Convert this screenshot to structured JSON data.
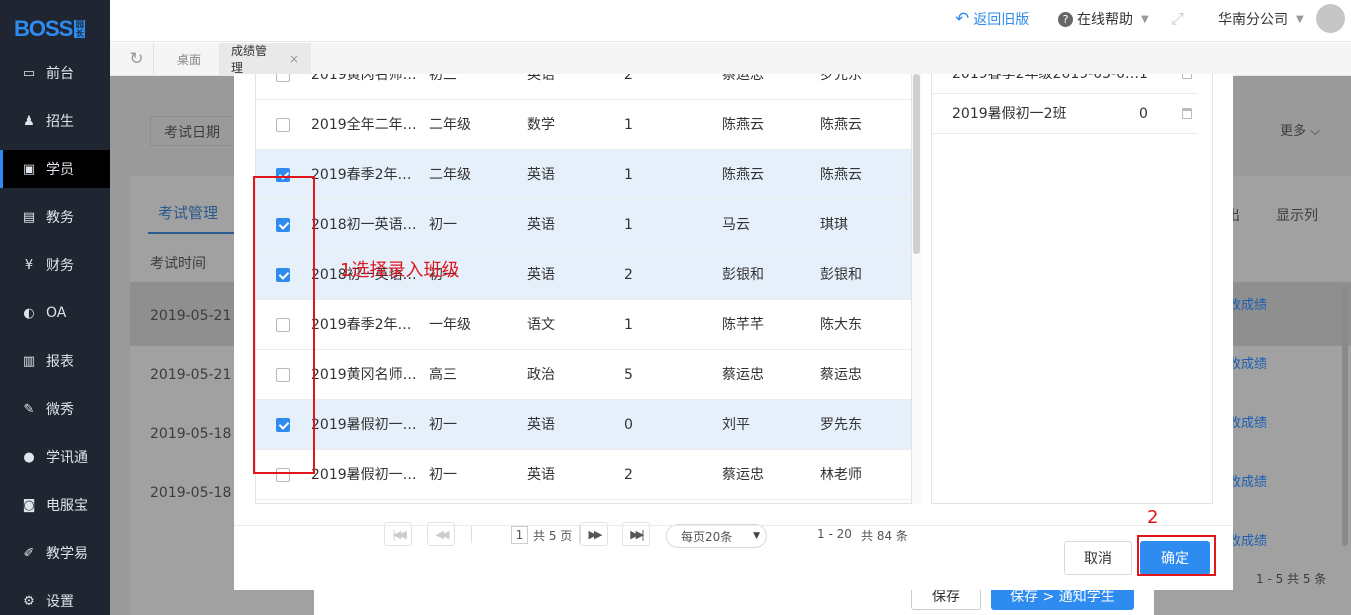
{
  "brand": {
    "logo": "BOSS",
    "logo_tag": "园长"
  },
  "sidebar": {
    "items": [
      {
        "label": "前台",
        "icon": "monitor-icon"
      },
      {
        "label": "招生",
        "icon": "user-add-icon"
      },
      {
        "label": "学员",
        "icon": "contact-card-icon"
      },
      {
        "label": "教务",
        "icon": "book-icon"
      },
      {
        "label": "财务",
        "icon": "yen-icon"
      },
      {
        "label": "OA",
        "icon": "oa-icon"
      },
      {
        "label": "报表",
        "icon": "bar-chart-icon"
      },
      {
        "label": "微秀",
        "icon": "weixiu-icon"
      },
      {
        "label": "学讯通",
        "icon": "location-icon"
      },
      {
        "label": "电服宝",
        "icon": "phone-icon"
      },
      {
        "label": "教学易",
        "icon": "teach-icon"
      },
      {
        "label": "设置",
        "icon": "gear-icon"
      }
    ]
  },
  "topbar": {
    "back_old": "返回旧版",
    "help": "在线帮助",
    "branch": "华南分公司"
  },
  "tabs": [
    {
      "label": "桌面"
    },
    {
      "label": "成绩管理"
    }
  ],
  "background": {
    "filter_label": "考试日期",
    "more_label": "更多",
    "subtab": "考试管理",
    "col_time": "考试时间",
    "export_partial": "出",
    "display_cols": "显示列",
    "dates": [
      "2019-05-21",
      "2019-05-21",
      "2019-05-18",
      "2019-05-18"
    ],
    "row_link": "修改成绩",
    "pager": "1 - 5   共 5 条",
    "save": "保存",
    "save_notify": "保存 > 通知学生"
  },
  "modal": {
    "class_rows": [
      {
        "name": "2019黄冈名师…",
        "grade": "初三",
        "subject": "英语",
        "count": "2",
        "teacher": "蔡运忠",
        "head": "罗先东",
        "checked": false
      },
      {
        "name": "2019全年二年…",
        "grade": "二年级",
        "subject": "数学",
        "count": "1",
        "teacher": "陈燕云",
        "head": "陈燕云",
        "checked": false
      },
      {
        "name": "2019春季2年…",
        "grade": "二年级",
        "subject": "英语",
        "count": "1",
        "teacher": "陈燕云",
        "head": "陈燕云",
        "checked": true
      },
      {
        "name": "2018初一英语…",
        "grade": "初一",
        "subject": "英语",
        "count": "1",
        "teacher": "马云",
        "head": "琪琪",
        "checked": true
      },
      {
        "name": "2018初一英语…",
        "grade": "初一",
        "subject": "英语",
        "count": "2",
        "teacher": "彭银和",
        "head": "彭银和",
        "checked": true
      },
      {
        "name": "2019春季2年…",
        "grade": "一年级",
        "subject": "语文",
        "count": "1",
        "teacher": "陈芊芊",
        "head": "陈大东",
        "checked": false
      },
      {
        "name": "2019黄冈名师…",
        "grade": "高三",
        "subject": "政治",
        "count": "5",
        "teacher": "蔡运忠",
        "head": "蔡运忠",
        "checked": false
      },
      {
        "name": "2019暑假初一…",
        "grade": "初一",
        "subject": "英语",
        "count": "0",
        "teacher": "刘平",
        "head": "罗先东",
        "checked": true
      },
      {
        "name": "2019暑假初一…",
        "grade": "初一",
        "subject": "英语",
        "count": "2",
        "teacher": "蔡运忠",
        "head": "林老师",
        "checked": false
      }
    ],
    "selected_rows": [
      {
        "name": "2019春季2年级2019-05-0…",
        "count": "1"
      },
      {
        "name": "2019暑假初一2班",
        "count": "0"
      }
    ],
    "pager": {
      "page": "1",
      "total_pages": "共 5 页",
      "per_page": "每页20条",
      "range": "1 - 20",
      "total": "共 84 条"
    },
    "cancel": "取消",
    "confirm": "确定"
  },
  "annotations": {
    "step1": "1选择录入班级",
    "step2": "2"
  },
  "colors": {
    "sidebar": "#1f2632",
    "accent": "#2e8cf0",
    "annotation": "#e0161c",
    "selected_row": "#e6f0fb"
  }
}
